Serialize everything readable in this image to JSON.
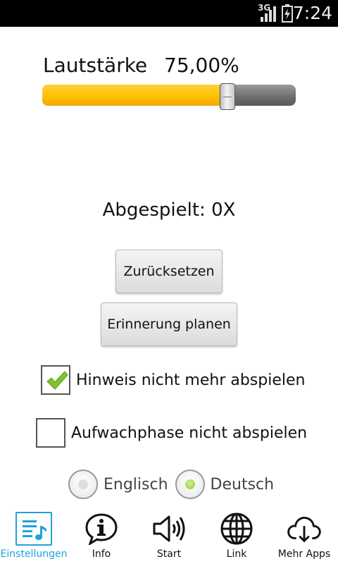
{
  "status_bar": {
    "network": "3G",
    "time": "7:24"
  },
  "volume": {
    "label": "Lautstärke",
    "value_text": "75,00%",
    "level_percent": 73,
    "fill_color": "#ffc000"
  },
  "played": {
    "text": "Abgespielt: 0X"
  },
  "buttons": {
    "reset": "Zurücksetzen",
    "reminder": "Erinnerung planen"
  },
  "options": {
    "hint_checkbox": {
      "label": "Hinweis nicht mehr abspielen",
      "checked": true
    },
    "wake_checkbox": {
      "label": "Aufwachphase nicht abspielen",
      "checked": false
    }
  },
  "language": {
    "options": [
      {
        "label": "Englisch",
        "selected": false
      },
      {
        "label": "Deutsch",
        "selected": true
      }
    ]
  },
  "nav": {
    "accent_color": "#1ea4dd",
    "items": [
      {
        "label": "Einstellungen",
        "icon": "settings-music-icon",
        "active": true
      },
      {
        "label": "Info",
        "icon": "info-icon",
        "active": false
      },
      {
        "label": "Start",
        "icon": "speaker-icon",
        "active": false
      },
      {
        "label": "Link",
        "icon": "globe-icon",
        "active": false
      },
      {
        "label": "Mehr Apps",
        "icon": "cloud-download-icon",
        "active": false
      }
    ]
  }
}
